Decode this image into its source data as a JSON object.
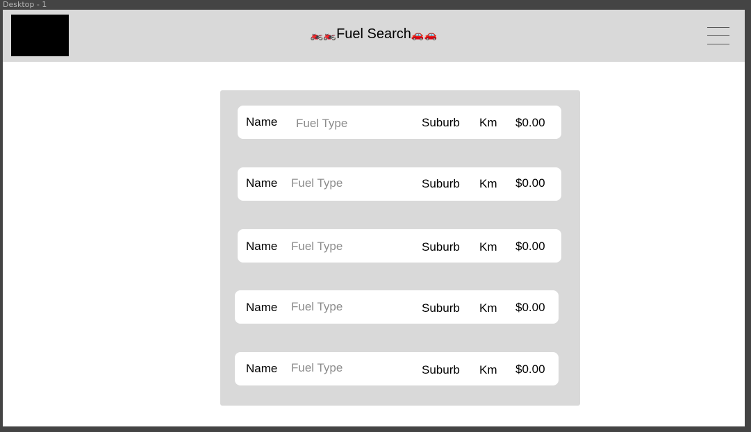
{
  "window": {
    "frame_label": "Desktop - 1"
  },
  "header": {
    "title_prefix_emoji": "🏍️🏍️",
    "title": "Fuel Search",
    "title_suffix_emoji": "🚗🚗"
  },
  "rows": [
    {
      "name": "Name",
      "fuel_type": "Fuel Type",
      "suburb": "Suburb",
      "km": "Km",
      "price": "$0.00"
    },
    {
      "name": "Name",
      "fuel_type": "Fuel Type",
      "suburb": "Suburb",
      "km": "Km",
      "price": "$0.00"
    },
    {
      "name": "Name",
      "fuel_type": "Fuel Type",
      "suburb": "Suburb",
      "km": "Km",
      "price": "$0.00"
    },
    {
      "name": "Name",
      "fuel_type": "Fuel Type",
      "suburb": "Suburb",
      "km": "Km",
      "price": "$0.00"
    },
    {
      "name": "Name",
      "fuel_type": "Fuel Type",
      "suburb": "Suburb",
      "km": "Km",
      "price": "$0.00"
    }
  ]
}
